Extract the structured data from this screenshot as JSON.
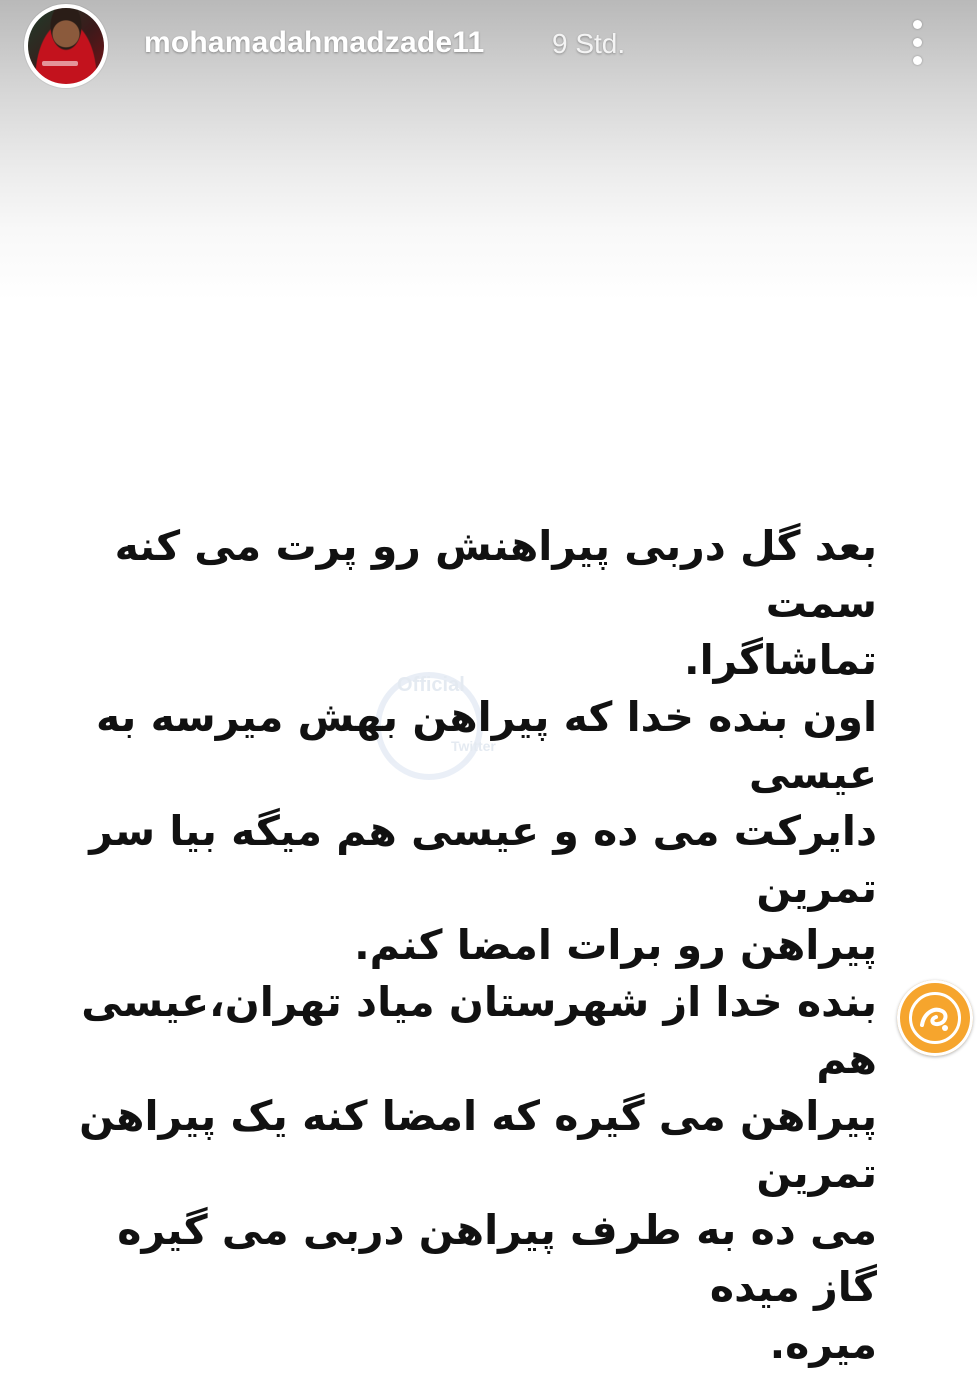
{
  "story": {
    "author": {
      "username": "mohamadahmadzade11",
      "time_ago": "9 Std."
    },
    "menu_icon": "more-vertical-icon",
    "text_paragraphs": [
      "بعد گل دربی پیراهنش رو پرت می کنه سمت\nتماشاگرا.",
      "اون بنده خدا که پیراهن بهش میرسه به عیسی\nدایرکت می ده و عیسی هم میگه بیا سر تمرین\nپیراهن رو برات امضا کنم.",
      "بنده خدا از شهرستان میاد تهران،عیسی هم\nپیراهن می گیره که امضا کنه یک پیراهن تمرین\nمی ده به طرف پیراهن دربی می گیره گاز میده\nمیره."
    ],
    "watermark": {
      "line1": "Official",
      "line2": "Twitter"
    }
  },
  "colors": {
    "header_gradient_top": "#b9b9b9",
    "background": "#ffffff",
    "text": "#111111",
    "logo": "#f6a52d"
  }
}
